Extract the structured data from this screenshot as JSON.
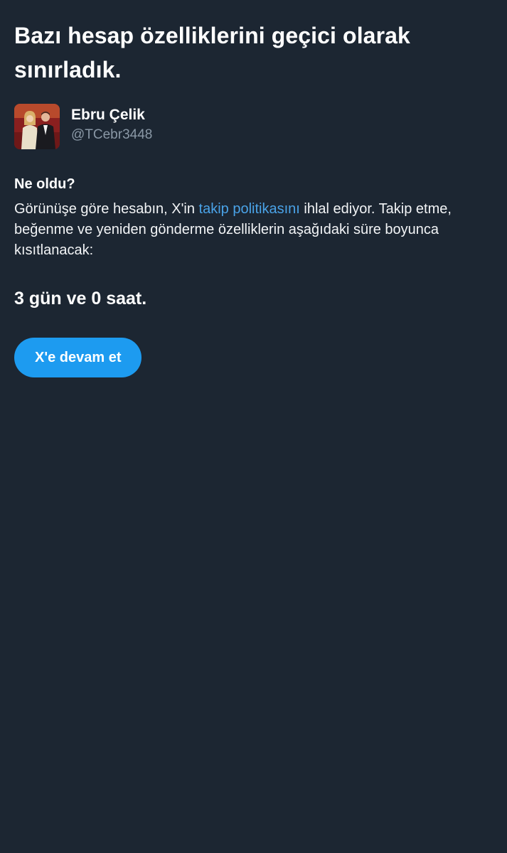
{
  "page": {
    "title": "Bazı hesap özelliklerini geçici olarak sınırladık."
  },
  "user": {
    "name": "Ebru Çelik",
    "handle": "@TCebr3448",
    "avatar_icon": "profile-photo-couple"
  },
  "what_happened": {
    "heading": "Ne oldu?",
    "text_before_link": "Görünüşe göre hesabın, X'in ",
    "link_text": "takip politikasını",
    "text_after_link": " ihlal ediyor. Takip etme, beğenme ve yeniden gönderme özelliklerin aşağıdaki süre boyunca kısıtlanacak:"
  },
  "duration": "3 gün ve 0 saat.",
  "continue_button": {
    "label": "X'e devam et"
  },
  "colors": {
    "background": "#1c2632",
    "accent": "#1d9bf0",
    "link": "#4aa3e8",
    "secondary_text": "#8a98a6"
  }
}
